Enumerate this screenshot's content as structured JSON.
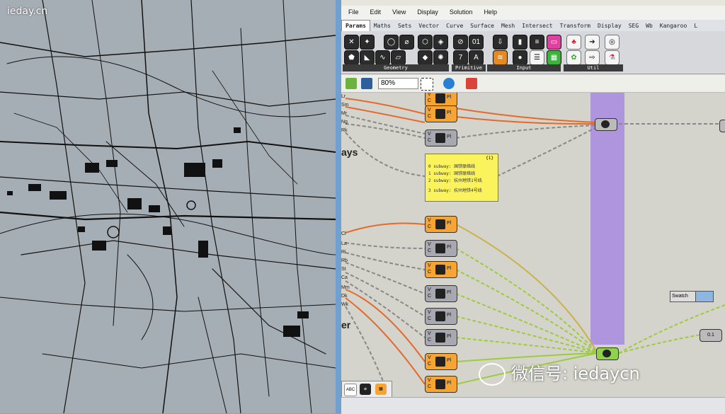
{
  "watermark_top": "ieday.cn",
  "watermark_bottom": "微信号: iedaycn",
  "menu": [
    "File",
    "Edit",
    "View",
    "Display",
    "Solution",
    "Help"
  ],
  "tabs": [
    "Params",
    "Maths",
    "Sets",
    "Vector",
    "Curve",
    "Surface",
    "Mesh",
    "Intersect",
    "Transform",
    "Display",
    "SEG",
    "Wb",
    "Kangaroo",
    "L"
  ],
  "active_tab": "Params",
  "toolbar_groups": [
    "Geometry",
    "Primitive",
    "Input",
    "Util"
  ],
  "zoom": "80%",
  "side_inputs_top": [
    "Lr",
    "Sm",
    "Mr",
    "Ng",
    "Rk"
  ],
  "side_inputs_bottom": [
    "Cl",
    "La",
    "Ri",
    "Rb",
    "St",
    "Ca",
    "Mm",
    "Dk",
    "Wk"
  ],
  "big_labels": [
    "ays",
    "er"
  ],
  "panel": {
    "index": "{1}",
    "rows": [
      "0 subway: 国铁联络线",
      "1 subway: 国铁联络线",
      "2 subway: 杭州地铁1号线",
      "3 subway: 杭州地铁4号线"
    ]
  },
  "comp_io": "V\nC",
  "comp_out": "Pl",
  "swatch_label": "Swatch",
  "num_node": "0.1",
  "colors": {
    "orange_comp": "#f6a434",
    "gray_comp": "#a8a8b0",
    "purple_group": "#a889e0",
    "wire_orange": "#e46a2c",
    "wire_green": "#9ccb3c"
  }
}
